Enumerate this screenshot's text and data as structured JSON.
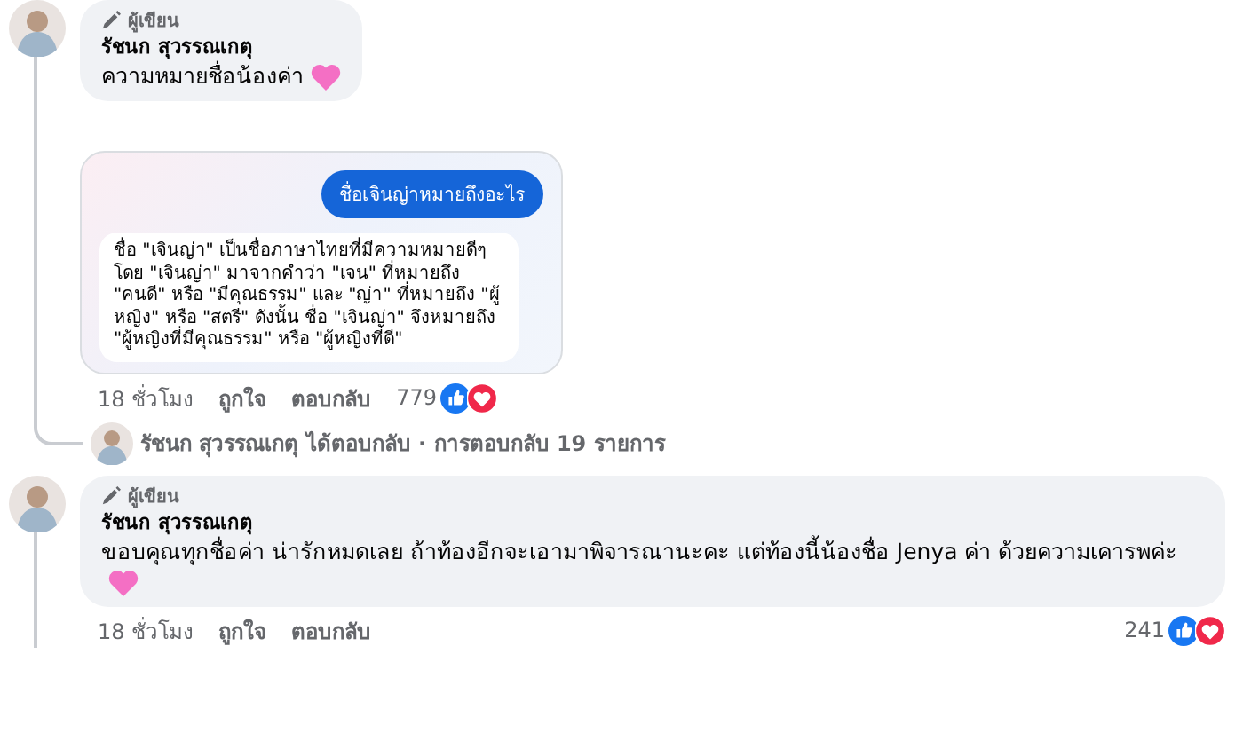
{
  "comments": [
    {
      "author_badge": "ผู้เขียน",
      "author": "รัชนก สุวรรณเกตุ",
      "text": "ความหมายชื่อน้องค่า",
      "attachment": {
        "question": "ชื่อเจินญ่าหมายถึงอะไร",
        "answer": "ชื่อ \"เจินญ่า\" เป็นชื่อภาษาไทยที่มีความหมายดีๆ โดย \"เจินญ่า\" มาจากคำว่า \"เจน\" ที่หมายถึง \"คนดี\" หรือ \"มีคุณธรรม\" และ \"ญ่า\" ที่หมายถึง \"ผู้หญิง\" หรือ \"สตรี\" ดังนั้น ชื่อ \"เจินญ่า\" จึงหมายถึง \"ผู้หญิงที่มีคุณธรรม\" หรือ \"ผู้หญิงที่ดี\""
      },
      "time": "18 ชั่วโมง",
      "like": "ถูกใจ",
      "reply": "ตอบกลับ",
      "reaction_count": "779",
      "replies_summary": "รัชนก สุวรรณเกตุ ได้ตอบกลับ · การตอบกลับ 19 รายการ"
    },
    {
      "author_badge": "ผู้เขียน",
      "author": "รัชนก สุวรรณเกตุ",
      "text": "ขอบคุณทุกชื่อค่า น่ารักหมดเลย ถ้าท้องอีกจะเอามาพิจารณานะคะ แต่ท้องนี้น้องชื่อ Jenya ค่า ด้วยความเคารพค่ะ",
      "time": "18 ชั่วโมง",
      "like": "ถูกใจ",
      "reply": "ตอบกลับ",
      "reaction_count": "241"
    }
  ]
}
